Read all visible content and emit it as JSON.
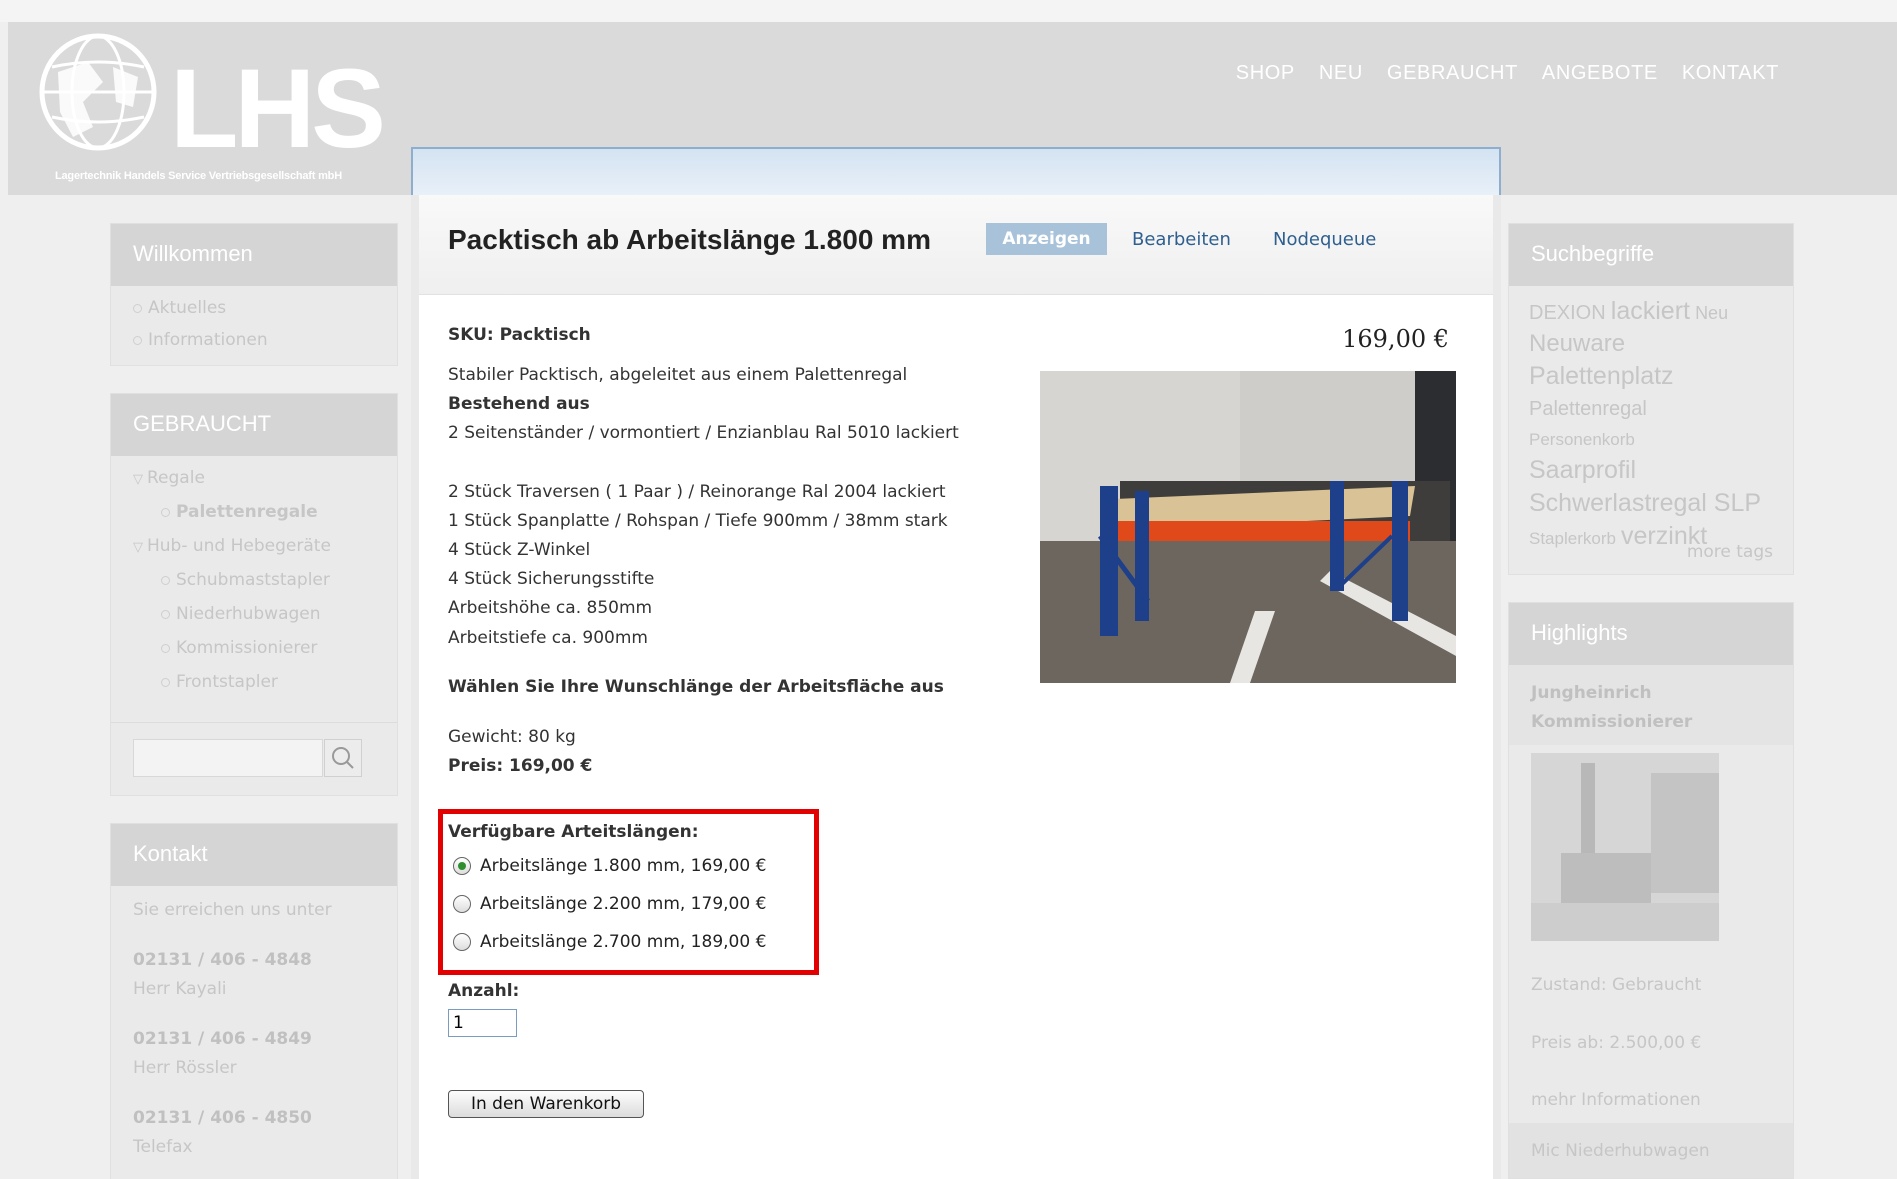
{
  "header": {
    "logo_text": "LHS",
    "logo_slogan": "Lagertechnik Handels Service Vertriebsgesellschaft mbH",
    "nav": [
      "SHOP",
      "NEU",
      "GEBRAUCHT",
      "ANGEBOTE",
      "KONTAKT"
    ]
  },
  "sidebar_left": {
    "welcome": {
      "title": "Willkommen",
      "items": [
        "Aktuelles",
        "Informationen"
      ]
    },
    "used": {
      "title": "GEBRAUCHT",
      "group1": "Regale",
      "group1_items": [
        "Palettenregale"
      ],
      "group2": "Hub- und Hebegeräte",
      "group2_items": [
        "Schubmaststapler",
        "Niederhubwagen",
        "Kommissionierer",
        "Frontstapler"
      ],
      "search_placeholder": ""
    },
    "contact": {
      "title": "Kontakt",
      "intro": "Sie erreichen uns unter",
      "entries": [
        {
          "phone": "02131 / 406 - 4848",
          "name": "Herr Kayali"
        },
        {
          "phone": "02131 / 406 - 4849",
          "name": "Herr Rössler"
        },
        {
          "phone": "02131 / 406 - 4850",
          "name": "Telefax"
        }
      ]
    }
  },
  "main": {
    "title": "Packtisch ab Arbeitslänge 1.800 mm",
    "tabs": {
      "view": "Anzeigen",
      "edit": "Bearbeiten",
      "nodequeue": "Nodequeue"
    },
    "sku": "SKU: Packtisch",
    "price_display": "169,00 €",
    "description": [
      "Stabiler Packtisch, abgeleitet aus einem Palettenregal",
      "Bestehend aus",
      "2 Seitenständer / vormontiert / Enzianblau Ral 5010 lackiert",
      "2 Stück Traversen ( 1 Paar ) / Reinorange Ral 2004 lackiert",
      "1 Stück Spanplatte / Rohspan / Tiefe 900mm / 38mm stark",
      "4 Stück Z-Winkel",
      "4 Stück Sicherungsstifte",
      "Arbeitshöhe ca. 850mm",
      "Arbeitstiefe ca. 900mm"
    ],
    "choose_length": "Wählen Sie Ihre Wunschlänge der Arbeitsfläche aus",
    "weight": "Gewicht: 80 kg",
    "price_line": "Preis: 169,00 €",
    "attributes_label": "Verfügbare Arteitslängen:",
    "options": [
      {
        "label": "Arbeitslänge 1.800 mm, 169,00 €",
        "checked": true
      },
      {
        "label": "Arbeitslänge 2.200 mm, 179,00 €",
        "checked": false
      },
      {
        "label": "Arbeitslänge 2.700 mm, 189,00 €",
        "checked": false
      }
    ],
    "qty_label": "Anzahl:",
    "qty_value": "1",
    "cart_button": "In den Warenkorb"
  },
  "sidebar_right": {
    "tags_title": "Suchbegriffe",
    "tags": [
      "DEXION",
      "lackiert",
      "Neu",
      "Neuware",
      "Palettenplatz",
      "Palettenregal",
      "Personenkorb",
      "Saarprofil",
      "Schwerlastregal SLP",
      "Staplerkorb",
      "verzinkt"
    ],
    "more_tags": "more tags",
    "highlights_title": "Highlights",
    "highlight_name": "Jungheinrich Kommissionierer",
    "highlight_condition": "Zustand: Gebraucht",
    "highlight_price": "Preis ab: 2.500,00 €",
    "highlight_more": "mehr Informationen",
    "next_highlight": "Mic Niederhubwagen"
  },
  "colors": {
    "accent_red": "#e20000",
    "tab_active": "#a8c2da",
    "link": "#2f5f8f"
  }
}
